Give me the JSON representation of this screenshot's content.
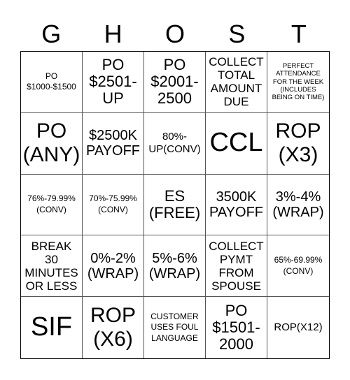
{
  "title_letters": [
    "G",
    "H",
    "O",
    "S",
    "T"
  ],
  "cells": [
    {
      "text": "PO\n$1000-$1500",
      "size": "s-s"
    },
    {
      "text": "PO\n$2501-\nUP",
      "size": "s-lm"
    },
    {
      "text": "PO\n$2001-\n2500",
      "size": "s-lm"
    },
    {
      "text": "COLLECT\nTOTAL\nAMOUNT\nDUE",
      "size": "s-m"
    },
    {
      "text": "PERFECT\nATTENDANCE\nFOR THE WEEK\n(INCLUDES\nBEING ON TIME)",
      "size": "s-xs"
    },
    {
      "text": "PO\n(ANY)",
      "size": "s-l"
    },
    {
      "text": "$2500K\nPAYOFF",
      "size": "s-lm-sm"
    },
    {
      "text": "80%-\nUP(CONV)",
      "size": "s-sm"
    },
    {
      "text": "CCL",
      "size": "s-xl"
    },
    {
      "text": "ROP\n(X3)",
      "size": "s-l"
    },
    {
      "text": "76%-79.99%\n(CONV)",
      "size": "s-s"
    },
    {
      "text": "70%-75.99%\n(CONV)",
      "size": "s-s"
    },
    {
      "text": "ES\n(FREE)",
      "size": "s-lm"
    },
    {
      "text": "3500K\nPAYOFF",
      "size": "s-lm-sm"
    },
    {
      "text": "3%-4%\n(WRAP)",
      "size": "s-lm-sm"
    },
    {
      "text": "BREAK\n30\nMINUTES\nOR LESS",
      "size": "s-m"
    },
    {
      "text": "0%-2%\n(WRAP)",
      "size": "s-lm-sm"
    },
    {
      "text": "5%-6%\n(WRAP)",
      "size": "s-lm-sm"
    },
    {
      "text": "COLLECT\nPYMT\nFROM\nSPOUSE",
      "size": "s-m"
    },
    {
      "text": "65%-69.99%\n(CONV)",
      "size": "s-s"
    },
    {
      "text": "SIF",
      "size": "s-xl"
    },
    {
      "text": "ROP\n(X6)",
      "size": "s-l"
    },
    {
      "text": "CUSTOMER\nUSES FOUL\nLANGUAGE",
      "size": "s-s"
    },
    {
      "text": "PO\n$1501-\n2000",
      "size": "s-lm"
    },
    {
      "text": "ROP(X12)",
      "size": "s-sm"
    }
  ]
}
